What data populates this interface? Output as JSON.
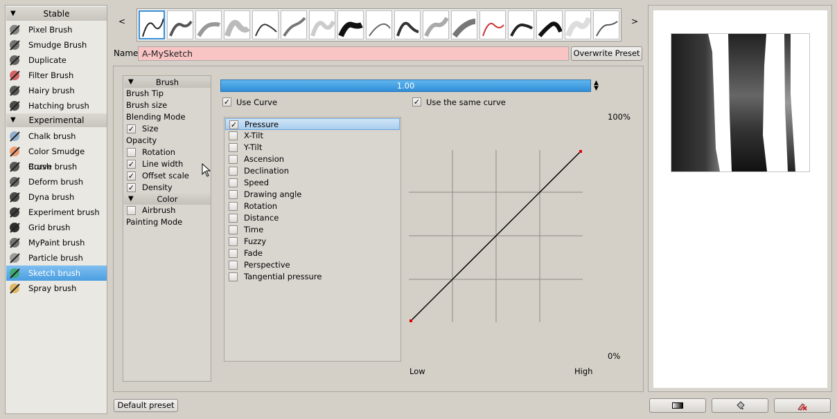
{
  "engines": {
    "groups": [
      {
        "label": "Stable",
        "items": [
          "Pixel Brush",
          "Smudge Brush",
          "Duplicate",
          "Filter Brush",
          "Hairy brush",
          "Hatching brush"
        ]
      },
      {
        "label": "Experimental",
        "items": [
          "Chalk brush",
          "Color Smudge Brush",
          "Curve brush",
          "Deform brush",
          "Dyna brush",
          "Experiment brush",
          "Grid brush",
          "MyPaint brush",
          "Particle brush",
          "Sketch brush",
          "Spray brush"
        ]
      }
    ],
    "selected": "Sketch brush"
  },
  "preset_strip": {
    "prev": "<",
    "next": ">"
  },
  "name_row": {
    "label": "Name:",
    "value": "A-MySketch",
    "overwrite_label": "Overwrite Preset"
  },
  "options": {
    "brush_header": "Brush",
    "items": [
      {
        "label": "Brush Tip",
        "check": null
      },
      {
        "label": "Brush size",
        "check": null
      },
      {
        "label": "Blending Mode",
        "check": null
      },
      {
        "label": "Size",
        "check": true
      },
      {
        "label": "Opacity",
        "check": null
      },
      {
        "label": "Rotation",
        "check": false
      },
      {
        "label": "Line width",
        "check": true
      },
      {
        "label": "Offset scale",
        "check": true
      },
      {
        "label": "Density",
        "check": true
      }
    ],
    "color_header": "Color",
    "color_items": [
      {
        "label": "Airbrush",
        "check": false
      },
      {
        "label": "Painting Mode",
        "check": null
      }
    ]
  },
  "curve_settings": {
    "slider_value": "1.00",
    "use_curve_label": "Use Curve",
    "use_curve": true,
    "same_curve_label": "Use the same curve",
    "same_curve": true,
    "sensors": [
      {
        "label": "Pressure",
        "checked": true
      },
      {
        "label": "X-Tilt",
        "checked": false
      },
      {
        "label": "Y-Tilt",
        "checked": false
      },
      {
        "label": "Ascension",
        "checked": false
      },
      {
        "label": "Declination",
        "checked": false
      },
      {
        "label": "Speed",
        "checked": false
      },
      {
        "label": "Drawing angle",
        "checked": false
      },
      {
        "label": "Rotation",
        "checked": false
      },
      {
        "label": "Distance",
        "checked": false
      },
      {
        "label": "Time",
        "checked": false
      },
      {
        "label": "Fuzzy",
        "checked": false
      },
      {
        "label": "Fade",
        "checked": false
      },
      {
        "label": "Perspective",
        "checked": false
      },
      {
        "label": "Tangential pressure",
        "checked": false
      }
    ],
    "graph": {
      "top_label": "100%",
      "bottom_label": "0%",
      "low_label": "Low",
      "high_label": "High"
    }
  },
  "footer": {
    "default_preset_label": "Default preset"
  },
  "icons": {
    "check": "✓",
    "triangle": "▼"
  }
}
